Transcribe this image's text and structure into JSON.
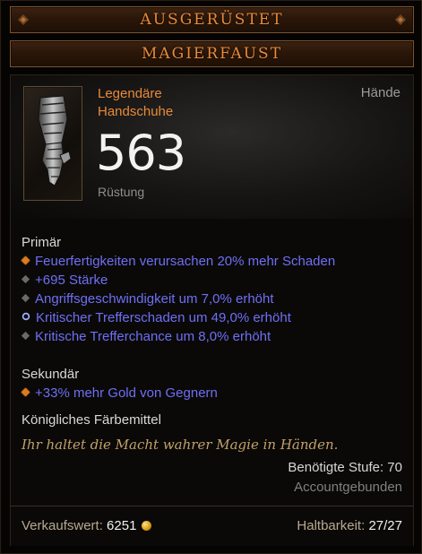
{
  "header": {
    "equipped_label": "AUSGERÜSTET",
    "item_name": "MAGIERFAUST"
  },
  "item": {
    "rarity_line1": "Legendäre",
    "rarity_line2": "Handschuhe",
    "slot": "Hände",
    "armor_value": "563",
    "armor_label": "Rüstung",
    "icon": "gauntlet-icon"
  },
  "primary": {
    "title": "Primär",
    "props": [
      {
        "text": "Feuerfertigkeiten verursachen 20% mehr Schaden",
        "bullet": "legendary-bullet-icon"
      },
      {
        "text": "+695 Stärke",
        "bullet": "bullet-icon"
      },
      {
        "text": "Angriffsgeschwindigkeit um 7,0% erhöht",
        "bullet": "bullet-icon"
      },
      {
        "text": "Kritischer Trefferschaden um 49,0% erhöht",
        "bullet": "enchanted-bullet-icon"
      },
      {
        "text": "Kritische Trefferchance um 8,0% erhöht",
        "bullet": "bullet-icon"
      }
    ]
  },
  "secondary": {
    "title": "Sekundär",
    "props": [
      {
        "text": "+33% mehr Gold von Gegnern",
        "bullet": "legendary-bullet-icon"
      }
    ]
  },
  "dye": "Königliches Färbemittel",
  "flavor": "Ihr haltet die Macht wahrer Magie in Händen.",
  "required_level": "Benötigte Stufe: 70",
  "bound": "Accountgebunden",
  "footer": {
    "sell_label": "Verkaufswert:",
    "sell_value": "6251",
    "durability_label": "Haltbarkeit:",
    "durability_value": "27/27"
  },
  "colors": {
    "legendary": "#e98a3a",
    "magic_property": "#6f6ff5",
    "flavor": "#c2a06a"
  }
}
